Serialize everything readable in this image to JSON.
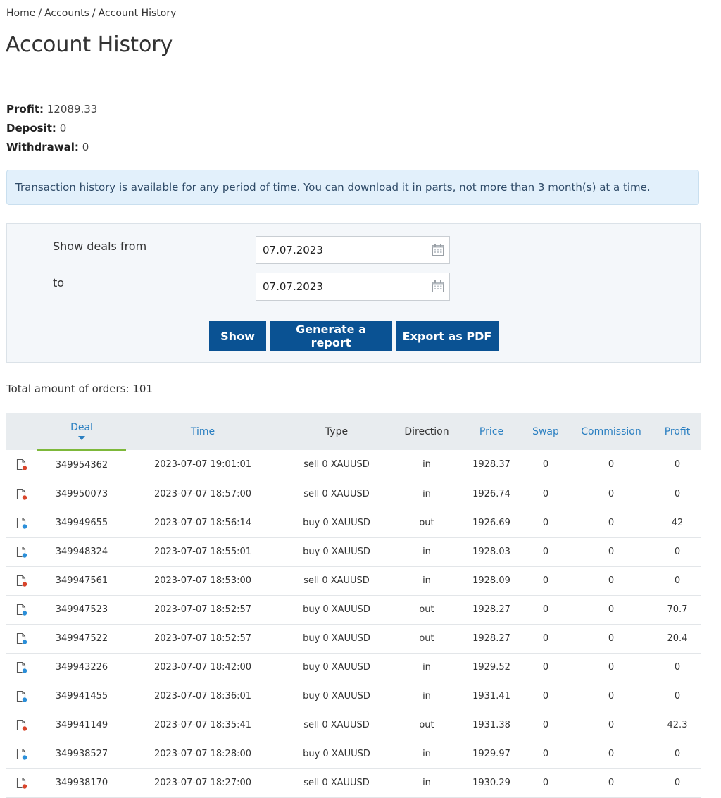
{
  "breadcrumb": {
    "items": [
      "Home",
      "Accounts",
      "Account History"
    ],
    "separator": "/"
  },
  "page_title": "Account History",
  "summary": {
    "profit_label": "Profit:",
    "profit_value": "12089.33",
    "deposit_label": "Deposit:",
    "deposit_value": "0",
    "withdrawal_label": "Withdrawal:",
    "withdrawal_value": "0"
  },
  "alert_text": "Transaction history is available for any period of time. You can download it in parts, not more than 3 month(s) at a time.",
  "filter": {
    "from_label": "Show deals from",
    "to_label": "to",
    "from_value": "07.07.2023",
    "to_value": "07.07.2023",
    "show_button": "Show",
    "report_button": "Generate a report",
    "pdf_button": "Export as PDF"
  },
  "total_orders": "Total amount of orders: 101",
  "table": {
    "headers": {
      "deal": "Deal",
      "time": "Time",
      "type": "Type",
      "direction": "Direction",
      "price": "Price",
      "swap": "Swap",
      "commission": "Commission",
      "profit": "Profit"
    },
    "rows": [
      {
        "icon": "sell",
        "deal": "349954362",
        "time": "2023-07-07 19:01:01",
        "type": "sell 0 XAUUSD",
        "direction": "in",
        "price": "1928.37",
        "swap": "0",
        "commission": "0",
        "profit": "0"
      },
      {
        "icon": "sell",
        "deal": "349950073",
        "time": "2023-07-07 18:57:00",
        "type": "sell 0 XAUUSD",
        "direction": "in",
        "price": "1926.74",
        "swap": "0",
        "commission": "0",
        "profit": "0"
      },
      {
        "icon": "buy",
        "deal": "349949655",
        "time": "2023-07-07 18:56:14",
        "type": "buy 0 XAUUSD",
        "direction": "out",
        "price": "1926.69",
        "swap": "0",
        "commission": "0",
        "profit": "42"
      },
      {
        "icon": "buy",
        "deal": "349948324",
        "time": "2023-07-07 18:55:01",
        "type": "buy 0 XAUUSD",
        "direction": "in",
        "price": "1928.03",
        "swap": "0",
        "commission": "0",
        "profit": "0"
      },
      {
        "icon": "sell",
        "deal": "349947561",
        "time": "2023-07-07 18:53:00",
        "type": "sell 0 XAUUSD",
        "direction": "in",
        "price": "1928.09",
        "swap": "0",
        "commission": "0",
        "profit": "0"
      },
      {
        "icon": "buy",
        "deal": "349947523",
        "time": "2023-07-07 18:52:57",
        "type": "buy 0 XAUUSD",
        "direction": "out",
        "price": "1928.27",
        "swap": "0",
        "commission": "0",
        "profit": "70.7"
      },
      {
        "icon": "buy",
        "deal": "349947522",
        "time": "2023-07-07 18:52:57",
        "type": "buy 0 XAUUSD",
        "direction": "out",
        "price": "1928.27",
        "swap": "0",
        "commission": "0",
        "profit": "20.4"
      },
      {
        "icon": "buy",
        "deal": "349943226",
        "time": "2023-07-07 18:42:00",
        "type": "buy 0 XAUUSD",
        "direction": "in",
        "price": "1929.52",
        "swap": "0",
        "commission": "0",
        "profit": "0"
      },
      {
        "icon": "buy",
        "deal": "349941455",
        "time": "2023-07-07 18:36:01",
        "type": "buy 0 XAUUSD",
        "direction": "in",
        "price": "1931.41",
        "swap": "0",
        "commission": "0",
        "profit": "0"
      },
      {
        "icon": "sell",
        "deal": "349941149",
        "time": "2023-07-07 18:35:41",
        "type": "sell 0 XAUUSD",
        "direction": "out",
        "price": "1931.38",
        "swap": "0",
        "commission": "0",
        "profit": "42.3"
      },
      {
        "icon": "buy",
        "deal": "349938527",
        "time": "2023-07-07 18:28:00",
        "type": "buy 0 XAUUSD",
        "direction": "in",
        "price": "1929.97",
        "swap": "0",
        "commission": "0",
        "profit": "0"
      },
      {
        "icon": "sell",
        "deal": "349938170",
        "time": "2023-07-07 18:27:00",
        "type": "sell 0 XAUUSD",
        "direction": "in",
        "price": "1930.29",
        "swap": "0",
        "commission": "0",
        "profit": "0"
      }
    ]
  },
  "icons": {
    "calendar": "calendar-icon",
    "sell": "sell-deal-icon",
    "buy": "buy-deal-icon"
  },
  "colors": {
    "primary_button": "#0a5293",
    "link": "#2a7fc1",
    "sort_underline": "#7db83a",
    "sell_dot": "#d9452b",
    "buy_dot": "#2b8fd9",
    "alert_bg": "#e2f0fb"
  }
}
